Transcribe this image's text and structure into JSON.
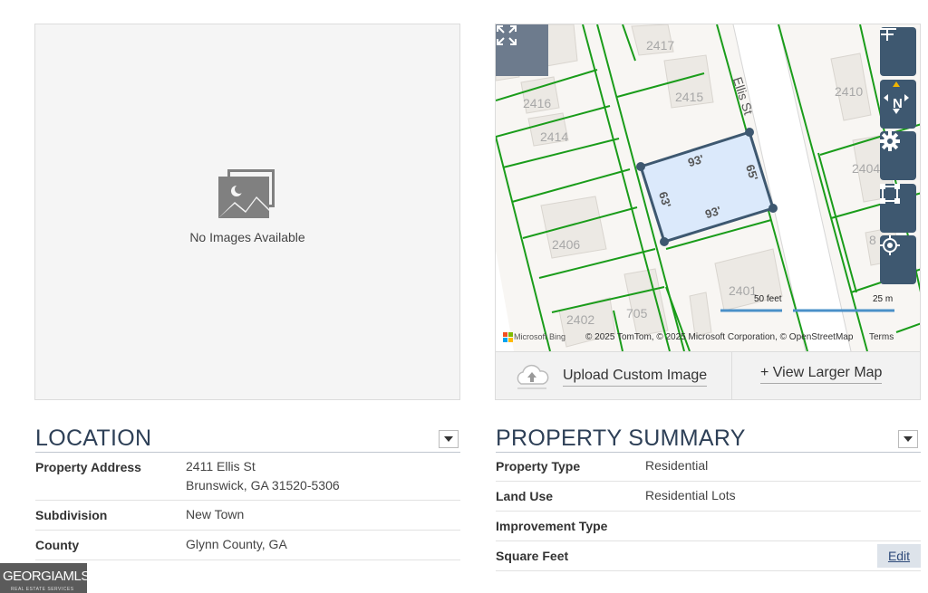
{
  "photo": {
    "icon": "no-image-icon",
    "no_images_text": "No Images Available"
  },
  "map": {
    "lot_labels": [
      "2417",
      "2415",
      "2416",
      "2414",
      "2410",
      "2404",
      "2406",
      "2401",
      "2402",
      "705",
      "8"
    ],
    "street_label": "Ellis St",
    "dimensions": {
      "top": "93'",
      "bottom": "93'",
      "left": "63'",
      "right": "65'"
    },
    "scale_feet": "50 feet",
    "scale_meters": "25 m",
    "brand": "Microsoft Bing",
    "attribution": "© 2025 TomTom, © 2025 Microsoft Corporation, © OpenStreetMap",
    "terms": "Terms",
    "controls": [
      "zoom-in-icon",
      "zoom-out-icon",
      "compass-icon",
      "settings-icon",
      "select-area-icon",
      "locate-icon"
    ],
    "compass_label": "N",
    "accent_color": "#3e5870",
    "parcel_fill": "#dbe9fb",
    "parcel_stroke": "#3e5870",
    "parcel_line_color": "#1a9c1a"
  },
  "map_footer": {
    "upload_label": "Upload Custom Image",
    "larger_map_label": "+ View Larger Map"
  },
  "location": {
    "title": "LOCATION",
    "rows": [
      {
        "label": "Property Address",
        "value_line1": "2411 Ellis St",
        "value_line2": "Brunswick, GA 31520-5306"
      },
      {
        "label": "Subdivision",
        "value_line1": "New Town"
      },
      {
        "label": "County",
        "value_line1": "Glynn County, GA"
      }
    ]
  },
  "summary": {
    "title": "PROPERTY SUMMARY",
    "rows": [
      {
        "label": "Property Type",
        "value": "Residential"
      },
      {
        "label": "Land Use",
        "value": "Residential Lots"
      },
      {
        "label": "Improvement Type",
        "value": ""
      },
      {
        "label": "Square Feet",
        "value": ""
      }
    ],
    "edit_label": "Edit"
  },
  "logo": {
    "line1": "GEORGIAMLS",
    "line2": "REAL ESTATE SERVICES"
  }
}
